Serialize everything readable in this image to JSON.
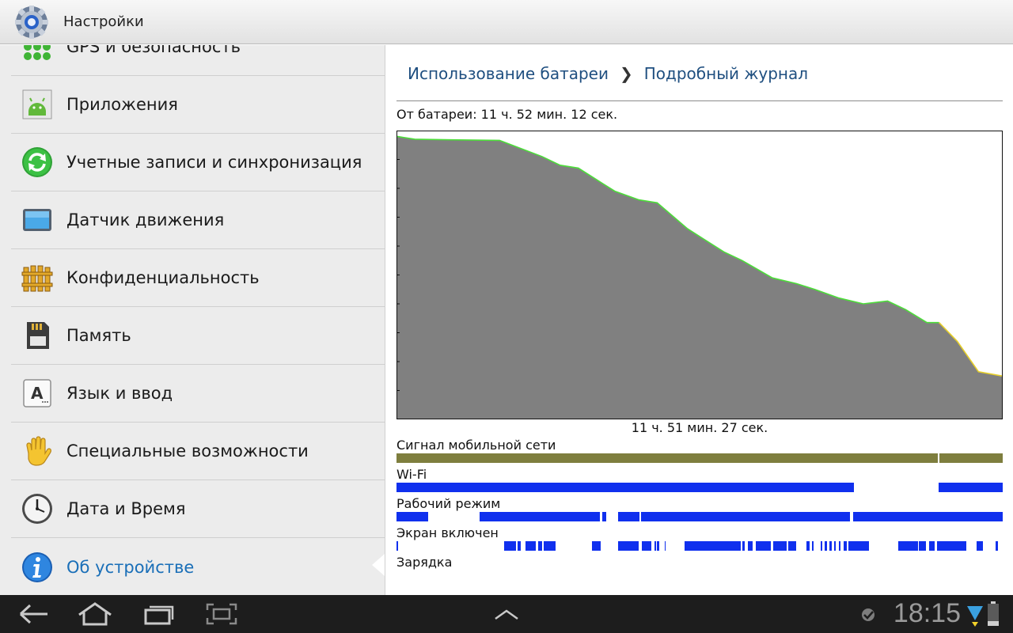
{
  "app": {
    "title": "Настройки",
    "icon": "settings-gear-icon"
  },
  "sidebar": {
    "items": [
      {
        "label": "GPS и безопасность",
        "icon": "gps-dots-icon"
      },
      {
        "label": "Приложения",
        "icon": "android-apps-icon"
      },
      {
        "label": "Учетные записи и синхронизация",
        "icon": "sync-icon"
      },
      {
        "label": "Датчик движения",
        "icon": "motion-tablet-icon"
      },
      {
        "label": "Конфиденциальность",
        "icon": "fence-privacy-icon"
      },
      {
        "label": "Память",
        "icon": "sd-card-icon"
      },
      {
        "label": "Язык и ввод",
        "icon": "keyboard-a-icon"
      },
      {
        "label": "Специальные возможности",
        "icon": "hand-icon"
      },
      {
        "label": "Дата и Время",
        "icon": "clock-icon"
      },
      {
        "label": "Об устройстве",
        "icon": "info-icon",
        "selected": true
      }
    ]
  },
  "detail": {
    "breadcrumb": {
      "parent": "Использование батареи",
      "current": "Подробный журнал"
    },
    "on_battery": "От батареи: 11 ч. 52 мин. 12 сек.",
    "graph_duration": "11 ч. 51 мин. 27 сек.",
    "tracks": {
      "signal": "Сигнал мобильной сети",
      "wifi": "Wi-Fi",
      "awake": "Рабочий режим",
      "screen": "Экран включен",
      "charging": "Зарядка"
    }
  },
  "chart_data": {
    "type": "area",
    "title": "",
    "x_duration": "11 ч. 51 мин. 27 сек.",
    "x": [
      0,
      0.03,
      0.09,
      0.17,
      0.19,
      0.24,
      0.27,
      0.3,
      0.33,
      0.36,
      0.4,
      0.43,
      0.48,
      0.54,
      0.57,
      0.62,
      0.66,
      0.69,
      0.73,
      0.77,
      0.81,
      0.84,
      0.875,
      0.895,
      0.925,
      0.96,
      1.0
    ],
    "values": [
      98,
      97,
      96.8,
      96.6,
      95,
      91,
      88,
      87,
      83,
      79,
      76,
      75,
      66,
      58,
      55,
      49,
      47,
      45,
      42,
      40,
      41,
      38,
      33.5,
      33.5,
      27,
      16.5,
      15
    ],
    "ylim": [
      0,
      100
    ],
    "unplugged_line_color": "#4ddd3a",
    "late_line_color": "#e6cf2a",
    "fill_color": "#808080"
  },
  "timeline": {
    "signal_color": "#7e7e3e",
    "bar_color": "#1030ee",
    "signal": [
      [
        0,
        0.893
      ],
      [
        0.895,
        1.0
      ]
    ],
    "wifi": [
      [
        0,
        0.755
      ],
      [
        0.894,
        1.0
      ]
    ],
    "awake": [
      [
        0,
        0.052
      ],
      [
        0.137,
        0.335
      ],
      [
        0.34,
        0.346
      ],
      [
        0.365,
        0.401
      ],
      [
        0.403,
        0.748
      ],
      [
        0.753,
        1.0
      ]
    ],
    "screen": [
      [
        0.0,
        0.002
      ],
      [
        0.177,
        0.197
      ],
      [
        0.2,
        0.205
      ],
      [
        0.213,
        0.23
      ],
      [
        0.233,
        0.24
      ],
      [
        0.243,
        0.262
      ],
      [
        0.323,
        0.337
      ],
      [
        0.365,
        0.4
      ],
      [
        0.405,
        0.42
      ],
      [
        0.425,
        0.428
      ],
      [
        0.43,
        0.434
      ],
      [
        0.442,
        0.444
      ],
      [
        0.475,
        0.568
      ],
      [
        0.571,
        0.574
      ],
      [
        0.58,
        0.588
      ],
      [
        0.593,
        0.618
      ],
      [
        0.621,
        0.643
      ],
      [
        0.646,
        0.659
      ],
      [
        0.676,
        0.682
      ],
      [
        0.685,
        0.688
      ],
      [
        0.7,
        0.702
      ],
      [
        0.706,
        0.71
      ],
      [
        0.714,
        0.718
      ],
      [
        0.722,
        0.725
      ],
      [
        0.73,
        0.733
      ],
      [
        0.737,
        0.743
      ],
      [
        0.746,
        0.78
      ],
      [
        0.828,
        0.86
      ],
      [
        0.862,
        0.873
      ],
      [
        0.878,
        0.888
      ],
      [
        0.891,
        0.94
      ],
      [
        0.957,
        0.968
      ],
      [
        0.988,
        0.992
      ]
    ],
    "charging": []
  },
  "system": {
    "clock": "18:15",
    "back_icon": "back-arrow-icon",
    "home_icon": "home-icon",
    "recent_icon": "recent-apps-icon",
    "screenshot_icon": "screenshot-icon",
    "menu_icon": "chevron-up-icon"
  }
}
